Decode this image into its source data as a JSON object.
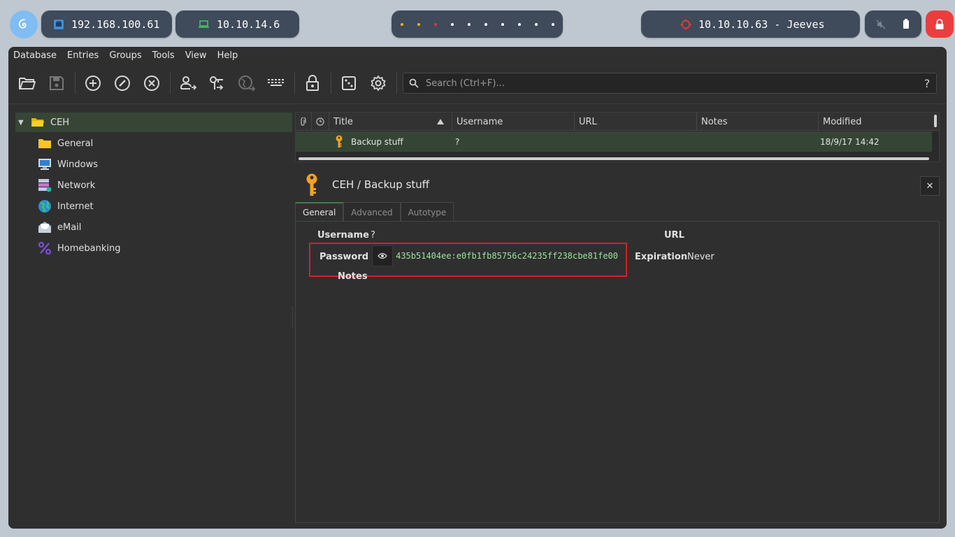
{
  "desktop": {
    "ip_local": "192.168.100.61",
    "ip_vpn": "10.10.14.6",
    "target": "10.10.10.63 - Jeeves",
    "colors": {
      "dot_active": "#f4b400",
      "dot_alert": "#e53935",
      "dot_normal": "#ffffff",
      "target_icon": "#e53935",
      "lock": "#ea3e3e"
    }
  },
  "menu": [
    "Database",
    "Entries",
    "Groups",
    "Tools",
    "View",
    "Help"
  ],
  "search": {
    "placeholder": "Search (Ctrl+F)...",
    "help": "?"
  },
  "groups": {
    "root": "CEH",
    "children": [
      "General",
      "Windows",
      "Network",
      "Internet",
      "eMail",
      "Homebanking"
    ]
  },
  "entries": {
    "columns": [
      "Title",
      "Username",
      "URL",
      "Notes",
      "Modified"
    ],
    "rows": [
      {
        "title": "Backup stuff",
        "username": "?",
        "url": "",
        "notes": "",
        "modified": "18/9/17 14:42"
      }
    ]
  },
  "preview": {
    "header": "CEH / Backup stuff",
    "close": "✕",
    "tabs": [
      "General",
      "Advanced",
      "Autotype"
    ],
    "fields": {
      "username_label": "Username",
      "username_value": "?",
      "password_label": "Password",
      "password_value": "435b51404ee:e0fb1fb85756c24235ff238cbe81fe00",
      "url_label": "URL",
      "expiration_label": "Expiration",
      "expiration_value": "Never",
      "notes_label": "Notes"
    }
  }
}
